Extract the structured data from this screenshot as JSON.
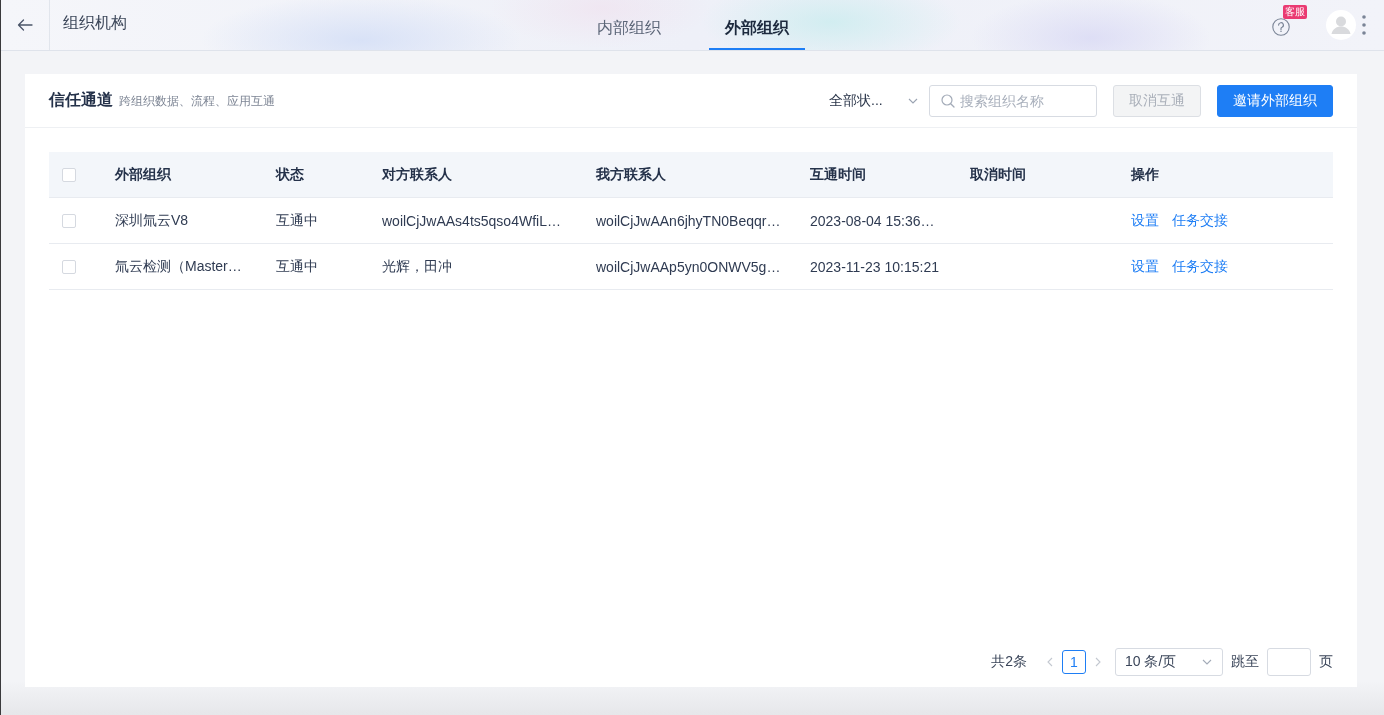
{
  "header": {
    "title": "组织机构",
    "tabs": [
      {
        "label": "内部组织",
        "selected": false
      },
      {
        "label": "外部组织",
        "selected": true
      }
    ],
    "help_badge": "客服"
  },
  "panel": {
    "title": "信任通道",
    "subtitle": "跨组织数据、流程、应用互通",
    "status_filter": "全部状...",
    "search": {
      "placeholder": "搜索组织名称"
    },
    "buttons": [
      {
        "label": "取消互通",
        "kind": "secondary",
        "disabled": true
      },
      {
        "label": "邀请外部组织",
        "kind": "primary",
        "disabled": false
      }
    ]
  },
  "table": {
    "all_checked": false,
    "columns": [
      "外部组织",
      "状态",
      "对方联系人",
      "我方联系人",
      "互通时间",
      "取消时间",
      "操作"
    ],
    "rows": [
      {
        "checked": false,
        "organization": "深圳氚云V8",
        "status": "互通中",
        "partner_contact": "woilCjJwAAs4ts5qso4WfiL…",
        "our_contact": "woilCjJwAAn6jhyTN0Beqqr…",
        "connected_time": "2023-08-04 15:36…",
        "actions": [
          "设置",
          "任务交接"
        ]
      },
      {
        "checked": false,
        "organization": "氚云检测（Master…",
        "status": "互通中",
        "partner_contact": "光辉，田冲",
        "our_contact": "woilCjJwAAp5yn0ONWV5g…",
        "connected_time": "2023-11-23 10:15:21",
        "actions": [
          "设置",
          "任务交接"
        ]
      }
    ]
  },
  "pagination": {
    "total": "共2条",
    "prev_disabled": true,
    "next_disabled": true,
    "pages": [
      {
        "label": "1",
        "selected": true
      }
    ],
    "page_size": "10 条/页",
    "jump_label": "跳至",
    "page_suffix": "页"
  }
}
